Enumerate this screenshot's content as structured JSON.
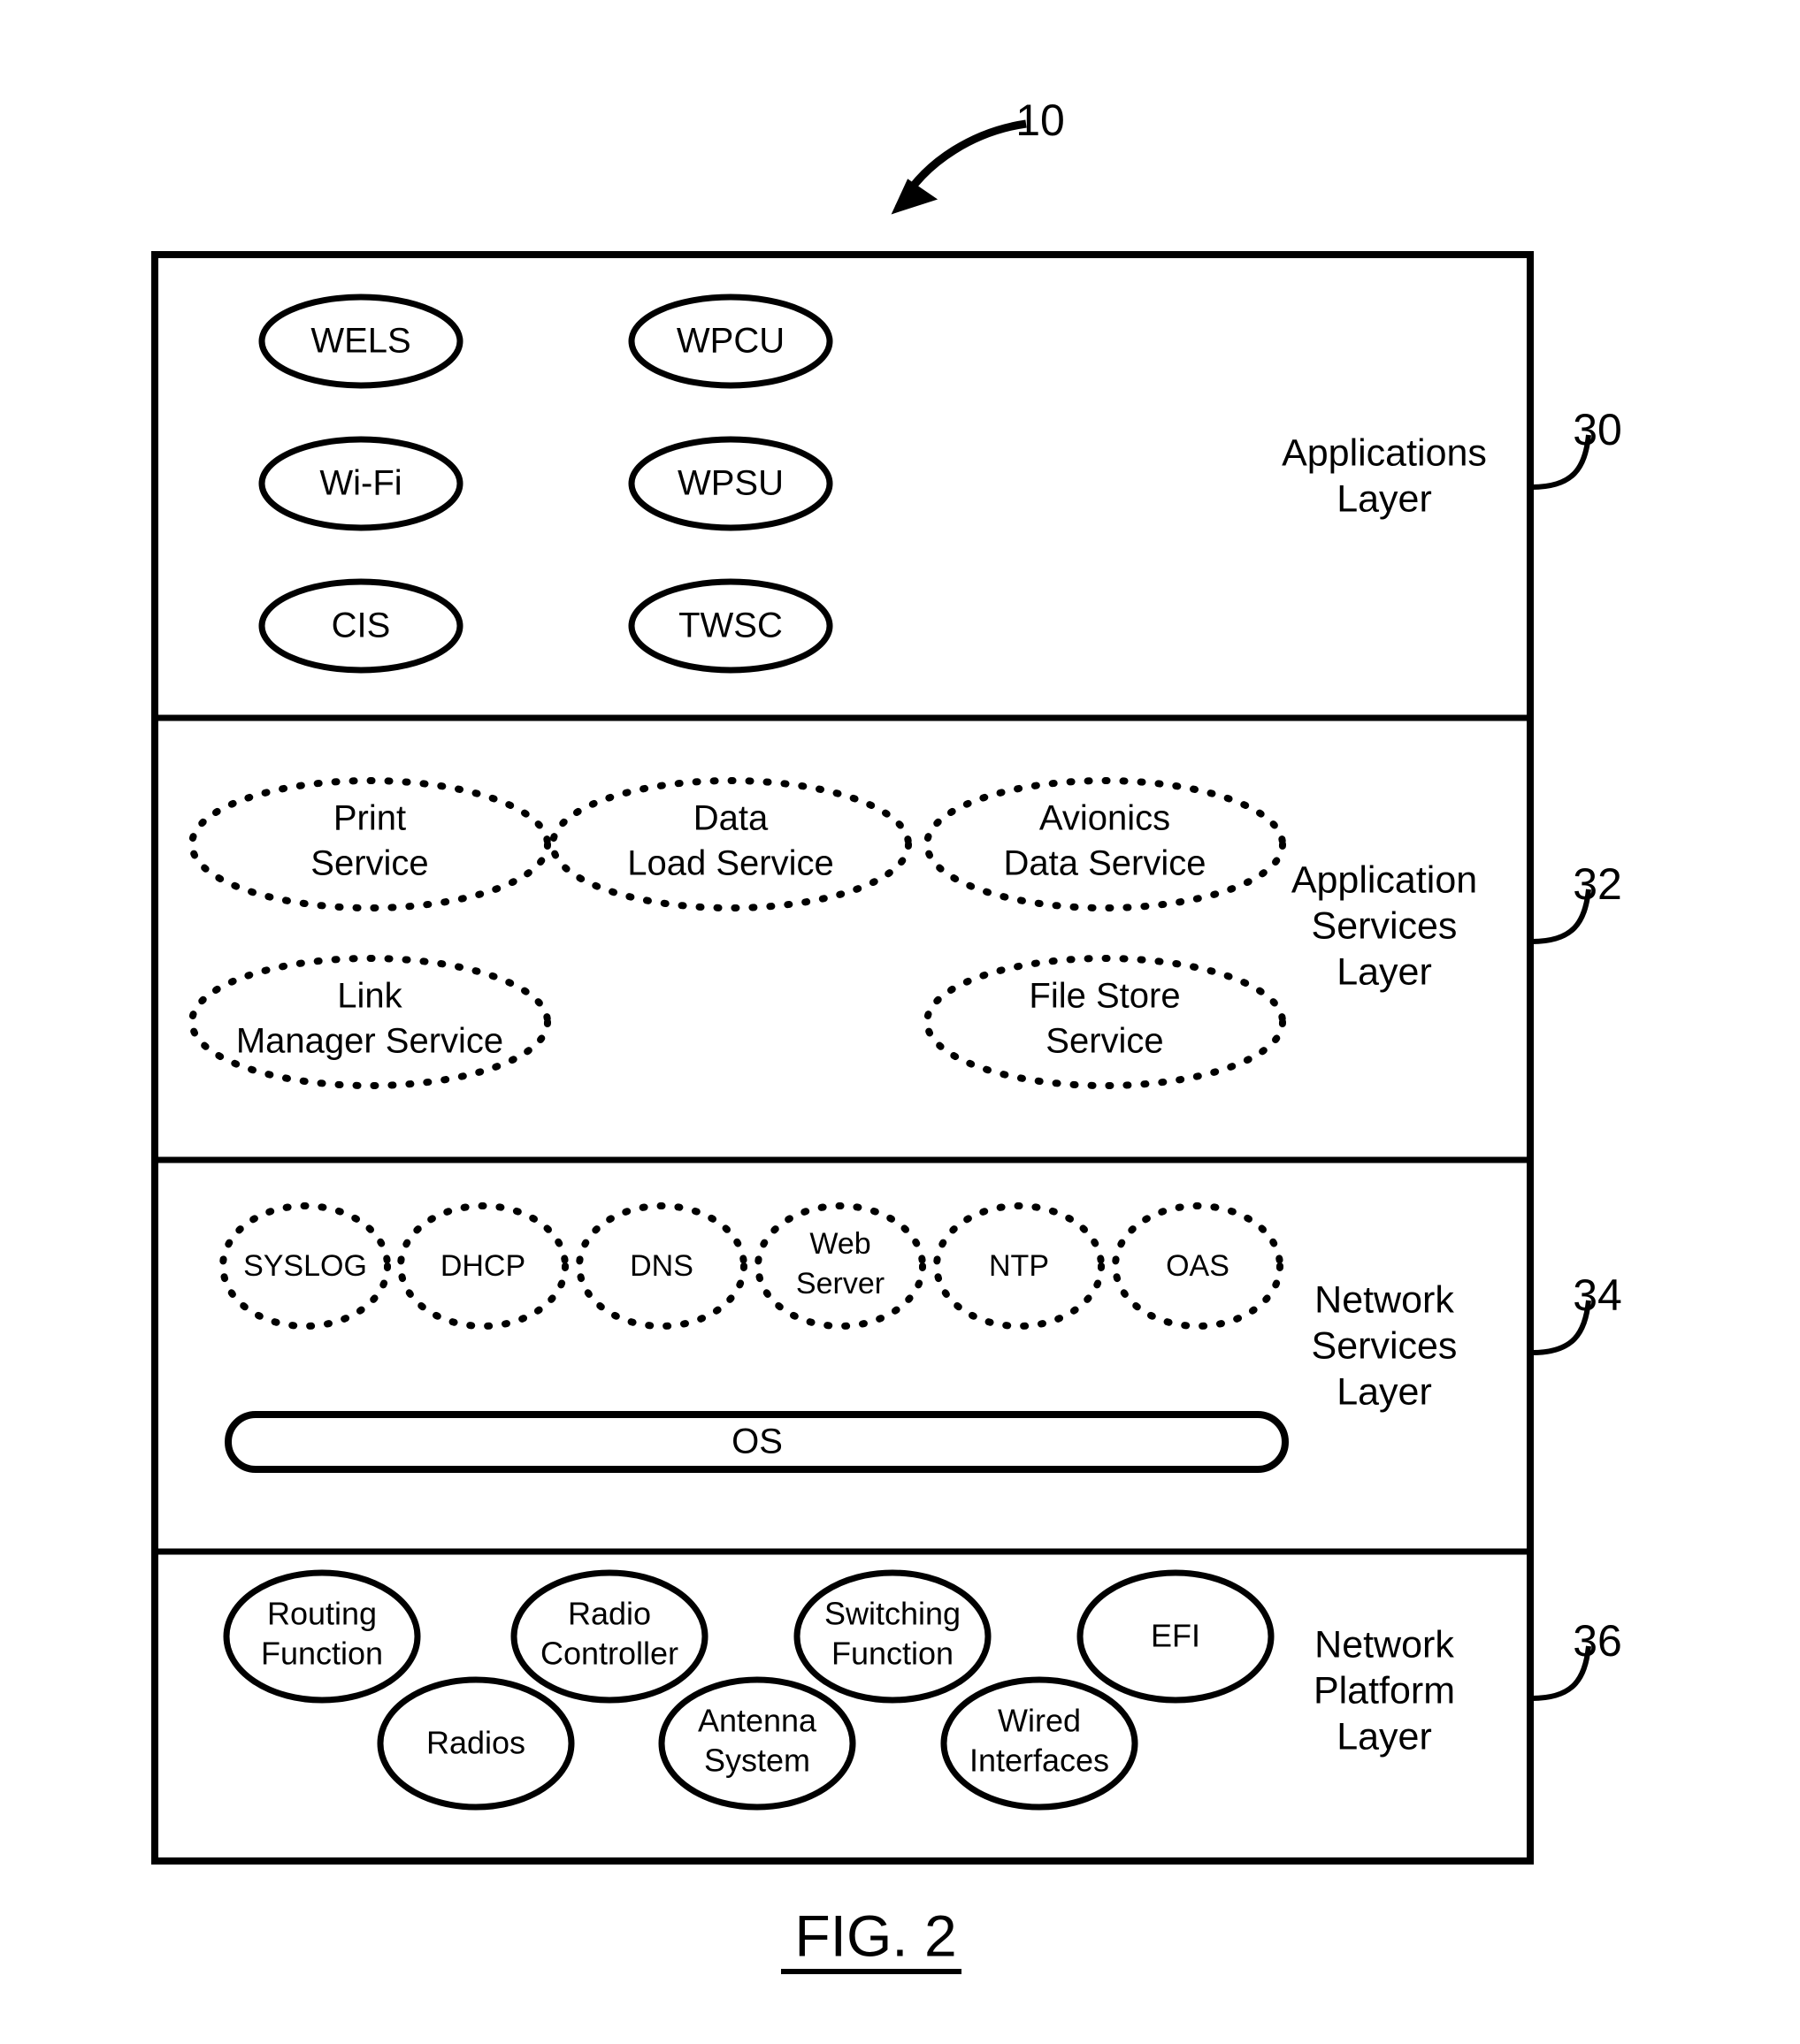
{
  "figure": {
    "caption": "FIG. 2",
    "system_ref": "10"
  },
  "layers": [
    {
      "id": "applications",
      "label_lines": [
        "Applications",
        "Layer"
      ],
      "ref": "30",
      "node_style": "solid-ellipse",
      "nodes": [
        {
          "label_lines": [
            "WELS"
          ]
        },
        {
          "label_lines": [
            "WPCU"
          ]
        },
        {
          "label_lines": [
            "Wi-Fi"
          ]
        },
        {
          "label_lines": [
            "WPSU"
          ]
        },
        {
          "label_lines": [
            "CIS"
          ]
        },
        {
          "label_lines": [
            "TWSC"
          ]
        }
      ]
    },
    {
      "id": "application-services",
      "label_lines": [
        "Application",
        "Services",
        "Layer"
      ],
      "ref": "32",
      "node_style": "dotted-ellipse",
      "nodes": [
        {
          "label_lines": [
            "Print",
            "Service"
          ]
        },
        {
          "label_lines": [
            "Data",
            "Load Service"
          ]
        },
        {
          "label_lines": [
            "Avionics",
            "Data Service"
          ]
        },
        {
          "label_lines": [
            "Link",
            "Manager Service"
          ]
        },
        {
          "label_lines": [
            "File Store",
            "Service"
          ]
        }
      ]
    },
    {
      "id": "network-services",
      "label_lines": [
        "Network",
        "Services",
        "Layer"
      ],
      "ref": "34",
      "node_style": "dotted-ellipse",
      "nodes": [
        {
          "label_lines": [
            "SYSLOG"
          ]
        },
        {
          "label_lines": [
            "DHCP"
          ]
        },
        {
          "label_lines": [
            "DNS"
          ]
        },
        {
          "label_lines": [
            "Web",
            "Server"
          ]
        },
        {
          "label_lines": [
            "NTP"
          ]
        },
        {
          "label_lines": [
            "OAS"
          ]
        }
      ],
      "os_box": {
        "label": "OS"
      }
    },
    {
      "id": "network-platform",
      "label_lines": [
        "Network",
        "Platform",
        "Layer"
      ],
      "ref": "36",
      "node_style": "solid-ellipse",
      "nodes": [
        {
          "label_lines": [
            "Routing",
            "Function"
          ]
        },
        {
          "label_lines": [
            "Radio",
            "Controller"
          ]
        },
        {
          "label_lines": [
            "Switching",
            "Function"
          ]
        },
        {
          "label_lines": [
            "EFI"
          ]
        },
        {
          "label_lines": [
            "Radios"
          ]
        },
        {
          "label_lines": [
            "Antenna",
            "System"
          ]
        },
        {
          "label_lines": [
            "Wired",
            "Interfaces"
          ]
        }
      ]
    }
  ],
  "colors": {
    "ink": "#000000",
    "paper": "#ffffff"
  }
}
